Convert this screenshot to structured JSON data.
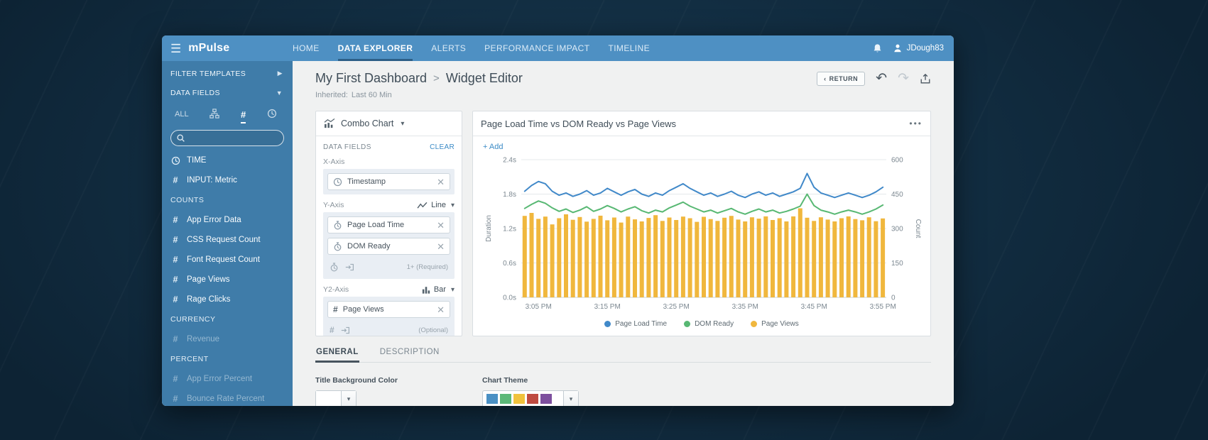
{
  "topnav": {
    "logo": "mPulse",
    "items": [
      "HOME",
      "DATA EXPLORER",
      "ALERTS",
      "PERFORMANCE IMPACT",
      "TIMELINE"
    ],
    "active_item": "DATA EXPLORER",
    "user": "JDough83"
  },
  "sidebar": {
    "filter_templates": "FILTER TEMPLATES",
    "data_fields": "DATA FIELDS",
    "tab_all": "ALL",
    "items": {
      "time": "TIME",
      "input_metric": "INPUT: Metric",
      "counts_header": "COUNTS",
      "app_error_data": "App Error Data",
      "css_request_count": "CSS Request Count",
      "font_request_count": "Font Request Count",
      "page_views": "Page Views",
      "rage_clicks": "Rage Clicks",
      "currency_header": "CURRENCY",
      "revenue": "Revenue",
      "percent_header": "PERCENT",
      "app_error_percent": "App Error Percent",
      "bounce_rate_percent": "Bounce Rate Percent"
    }
  },
  "header": {
    "breadcrumb_dashboard": "My First Dashboard",
    "breadcrumb_separator": ">",
    "breadcrumb_page": "Widget Editor",
    "inherited_label": "Inherited:",
    "inherited_value": "Last 60 Min",
    "return_label": "RETURN"
  },
  "editor": {
    "chart_type": "Combo Chart",
    "data_fields_label": "DATA FIELDS",
    "clear_label": "CLEAR",
    "x_axis_label": "X-Axis",
    "x_chip": "Timestamp",
    "y_axis_label": "Y-Axis",
    "y_type": "Line",
    "y_chip_1": "Page Load Time",
    "y_chip_2": "DOM Ready",
    "y_hint": "1+ (Required)",
    "y2_axis_label": "Y2-Axis",
    "y2_type": "Bar",
    "y2_chip_1": "Page Views",
    "y2_hint": "(Optional)"
  },
  "widget": {
    "title": "Page Load Time vs DOM Ready vs Page Views",
    "menu": "•••",
    "add_label": "+ Add"
  },
  "chart_data": {
    "type": "combo",
    "title": "Page Load Time vs DOM Ready vs Page Views",
    "x": [
      "3:03 PM",
      "3:04 PM",
      "3:05 PM",
      "3:06 PM",
      "3:07 PM",
      "3:08 PM",
      "3:09 PM",
      "3:10 PM",
      "3:11 PM",
      "3:12 PM",
      "3:13 PM",
      "3:14 PM",
      "3:15 PM",
      "3:16 PM",
      "3:17 PM",
      "3:18 PM",
      "3:19 PM",
      "3:20 PM",
      "3:21 PM",
      "3:22 PM",
      "3:23 PM",
      "3:24 PM",
      "3:25 PM",
      "3:26 PM",
      "3:27 PM",
      "3:28 PM",
      "3:29 PM",
      "3:30 PM",
      "3:31 PM",
      "3:32 PM",
      "3:33 PM",
      "3:34 PM",
      "3:35 PM",
      "3:36 PM",
      "3:37 PM",
      "3:38 PM",
      "3:39 PM",
      "3:40 PM",
      "3:41 PM",
      "3:42 PM",
      "3:43 PM",
      "3:44 PM",
      "3:45 PM",
      "3:46 PM",
      "3:47 PM",
      "3:48 PM",
      "3:49 PM",
      "3:50 PM",
      "3:51 PM",
      "3:52 PM",
      "3:53 PM",
      "3:54 PM",
      "3:55 PM"
    ],
    "x_tick_labels": [
      "3:05 PM",
      "3:15 PM",
      "3:25 PM",
      "3:35 PM",
      "3:45 PM",
      "3:55 PM"
    ],
    "x_tick_indices": [
      2,
      12,
      22,
      32,
      42,
      52
    ],
    "series": [
      {
        "name": "Page Load Time",
        "type": "line",
        "axis": "left",
        "color": "#4189c9",
        "values": [
          1.85,
          1.95,
          2.02,
          1.98,
          1.85,
          1.78,
          1.82,
          1.76,
          1.8,
          1.86,
          1.78,
          1.82,
          1.9,
          1.84,
          1.78,
          1.84,
          1.88,
          1.8,
          1.76,
          1.82,
          1.78,
          1.86,
          1.92,
          1.98,
          1.9,
          1.84,
          1.78,
          1.82,
          1.76,
          1.8,
          1.85,
          1.78,
          1.74,
          1.8,
          1.84,
          1.78,
          1.82,
          1.76,
          1.8,
          1.84,
          1.9,
          2.16,
          1.92,
          1.82,
          1.78,
          1.74,
          1.78,
          1.82,
          1.78,
          1.74,
          1.78,
          1.84,
          1.92
        ]
      },
      {
        "name": "DOM Ready",
        "type": "line",
        "axis": "left",
        "color": "#58b873",
        "values": [
          1.55,
          1.62,
          1.68,
          1.64,
          1.56,
          1.5,
          1.54,
          1.48,
          1.52,
          1.58,
          1.5,
          1.54,
          1.6,
          1.55,
          1.49,
          1.54,
          1.58,
          1.51,
          1.47,
          1.52,
          1.49,
          1.56,
          1.61,
          1.66,
          1.59,
          1.54,
          1.49,
          1.52,
          1.47,
          1.51,
          1.55,
          1.49,
          1.45,
          1.5,
          1.54,
          1.49,
          1.52,
          1.47,
          1.5,
          1.54,
          1.59,
          1.8,
          1.6,
          1.52,
          1.49,
          1.45,
          1.49,
          1.52,
          1.49,
          1.45,
          1.49,
          1.54,
          1.61
        ]
      },
      {
        "name": "Page Views",
        "type": "bar",
        "axis": "right",
        "color": "#f0b73d",
        "values": [
          355,
          368,
          342,
          352,
          318,
          345,
          362,
          338,
          350,
          330,
          342,
          356,
          336,
          348,
          326,
          352,
          340,
          331,
          346,
          358,
          333,
          348,
          337,
          352,
          345,
          329,
          351,
          341,
          333,
          347,
          355,
          339,
          331,
          349,
          343,
          353,
          337,
          345,
          331,
          353,
          388,
          347,
          333,
          349,
          339,
          331,
          345,
          353,
          341,
          336,
          349,
          332,
          344
        ]
      }
    ],
    "left_axis": {
      "label": "Duration",
      "ticks": [
        "0.0s",
        "0.6s",
        "1.2s",
        "1.8s",
        "2.4s"
      ],
      "min": 0,
      "max": 2.4
    },
    "right_axis": {
      "label": "Count",
      "ticks": [
        "0",
        "150",
        "300",
        "450",
        "600"
      ],
      "min": 0,
      "max": 600
    },
    "grid": true,
    "legend_position": "bottom"
  },
  "footer": {
    "tab_general": "GENERAL",
    "tab_description": "DESCRIPTION",
    "title_bg_label": "Title Background Color",
    "title_background_color": "#ffffff",
    "chart_theme_label": "Chart Theme",
    "theme_swatches": [
      "#4a90c4",
      "#5cb878",
      "#f0c23d",
      "#bf4b41",
      "#7d4f9e"
    ]
  }
}
